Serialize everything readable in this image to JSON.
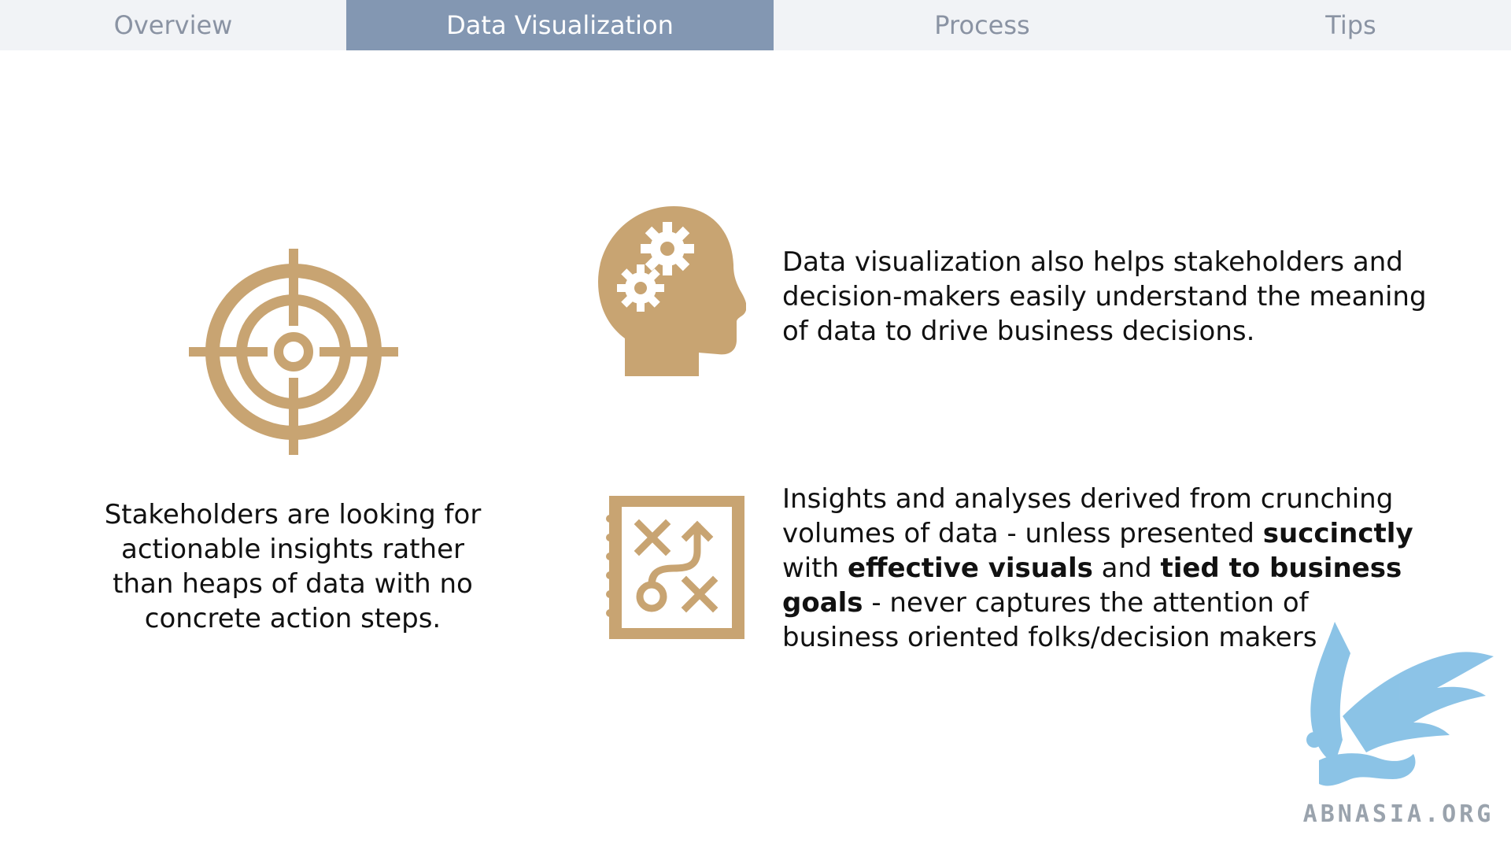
{
  "tabs": [
    {
      "label": "Overview",
      "active": false
    },
    {
      "label": "Data Visualization",
      "active": true
    },
    {
      "label": "Process",
      "active": false
    },
    {
      "label": "Tips",
      "active": false
    }
  ],
  "colors": {
    "tab_bar_bg": "#f1f3f6",
    "tab_active_bg": "#8397b2",
    "tab_text": "#8a93a3",
    "icon_gold": "#c8a472",
    "watermark_blue": "#7fbde4"
  },
  "icons": {
    "target": "crosshair-target-icon",
    "head": "head-with-gears-icon",
    "plan": "strategy-notebook-icon",
    "watermark": "griffin-logo"
  },
  "content": {
    "left_caption": "Stakeholders are looking for actionable insights rather than heaps of data with no concrete action steps.",
    "right_text_1": "Data visualization also helps stakeholders and decision-makers easily understand the meaning of data to drive business decisions.",
    "right_text_2": {
      "p1": "Insights and analyses derived from crunching volumes of data - unless presented ",
      "b1": "succinctly",
      "p2": " with ",
      "b2": "effective visuals",
      "p3": " and ",
      "b3": "tied to business goals",
      "p4": " - never captures the attention of business oriented folks/decision makers"
    }
  },
  "watermark": {
    "text": "ABNASIA.ORG"
  }
}
